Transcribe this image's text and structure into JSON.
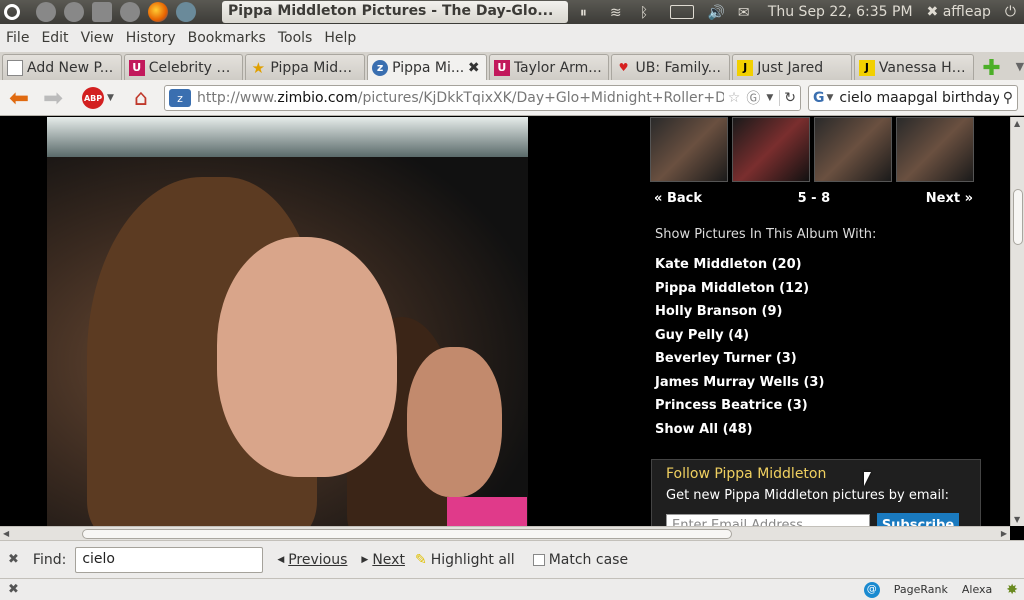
{
  "panel": {
    "window_title": "Pippa Middleton Pictures - The Day-Glo...",
    "datetime": "Thu Sep 22,  6:35 PM",
    "user": "affleap"
  },
  "menu": [
    "File",
    "Edit",
    "View",
    "History",
    "Bookmarks",
    "Tools",
    "Help"
  ],
  "tabs": [
    {
      "label": "Add New P...",
      "icon": "page-icon"
    },
    {
      "label": "Celebrity N...",
      "icon": "us-magazine-icon"
    },
    {
      "label": "Pippa Middl...",
      "icon": "star-icon"
    },
    {
      "label": "Pippa Mi...",
      "icon": "zimbio-icon",
      "active": true
    },
    {
      "label": "Taylor Arm...",
      "icon": "us-magazine-icon"
    },
    {
      "label": "UB: Family...",
      "icon": "heart-icon"
    },
    {
      "label": "Just Jared",
      "icon": "jj-icon"
    },
    {
      "label": "Vanessa Hu...",
      "icon": "jj-icon"
    }
  ],
  "nav": {
    "url_prefix": "http://www.",
    "url_domain": "zimbio.com",
    "url_rest": "/pictures/KjDkkTqixXK/Day+Glo+Midnight+Roller+Disco-",
    "search_text": "cielo maapgal birthday"
  },
  "gallery": {
    "back_label": "Back",
    "page_range": "5 - 8",
    "next_label": "Next",
    "album_heading": "Show Pictures In This Album With:",
    "people": [
      "Kate Middleton (20)",
      "Pippa Middleton (12)",
      "Holly Branson (9)",
      "Guy Pelly (4)",
      "Beverley Turner (3)",
      "James Murray Wells (3)",
      "Princess Beatrice (3)",
      "Show All (48)"
    ],
    "follow_title": "Follow Pippa Middleton",
    "follow_sub": "Get new Pippa Middleton pictures by email:",
    "email_placeholder": "Enter Email Address",
    "subscribe_label": "Subscribe"
  },
  "find": {
    "label": "Find:",
    "value": "cielo",
    "previous_label": "Previous",
    "next_label": "Next",
    "highlight_label": "Highlight all",
    "match_case_label": "Match case"
  },
  "status": {
    "pagerank_label": "PageRank",
    "alexa_label": "Alexa"
  },
  "colors": {
    "panel_bg": "#3c3b37",
    "follow_title": "#f0d060",
    "subscribe_bg": "#1a7abf"
  }
}
